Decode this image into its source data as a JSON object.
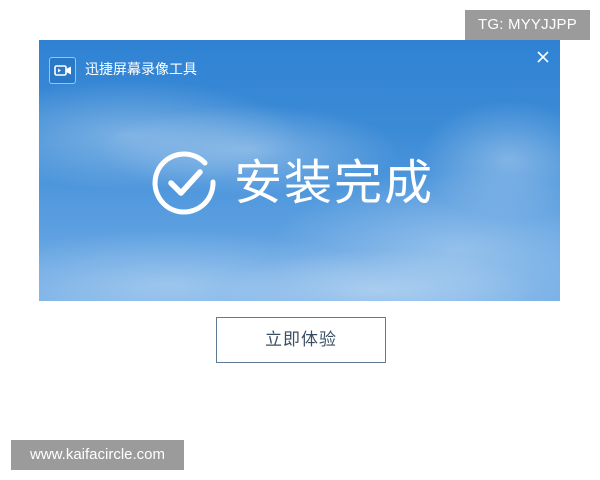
{
  "watermarks": {
    "telegram": "TG: MYYJJPP",
    "site": "www.kaifacircle.com"
  },
  "window": {
    "app_title": "迅捷屏幕录像工具",
    "logo_icon": "video-camera-icon",
    "close_icon": "close-icon"
  },
  "status": {
    "icon": "check-circle-icon",
    "text": "安装完成"
  },
  "actions": {
    "try_now_label": "立即体验"
  },
  "colors": {
    "window_background": "#3c8bd6",
    "button_border": "#5f7a95",
    "watermark_background": "#9b9b9b"
  }
}
